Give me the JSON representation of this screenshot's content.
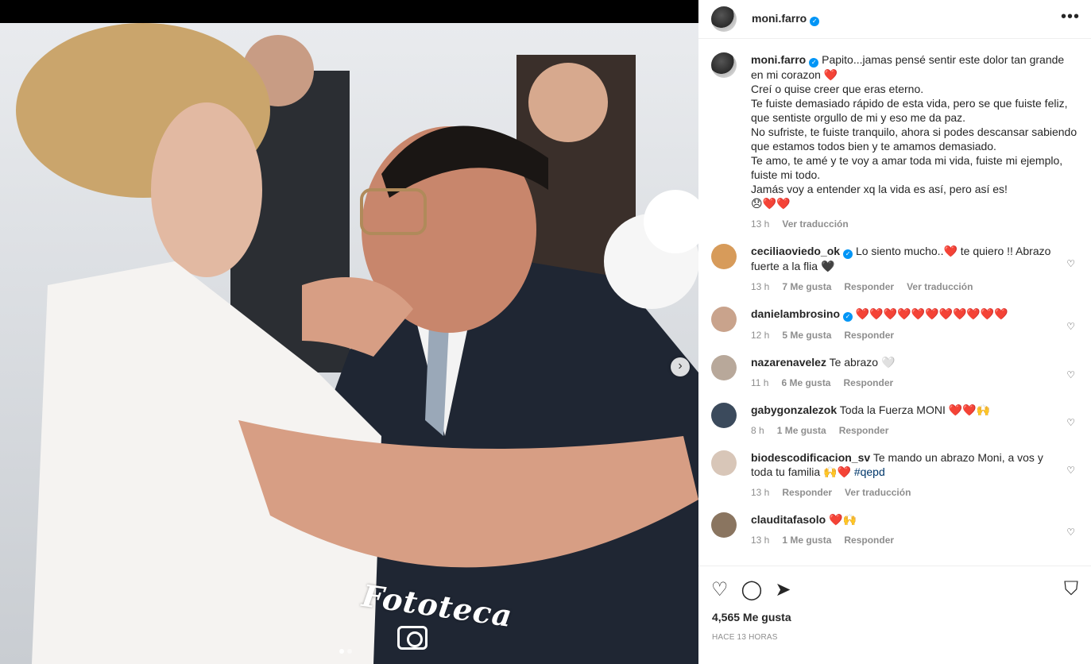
{
  "post": {
    "username": "moni.farro",
    "watermark": "Fototeca",
    "more_label": "•••"
  },
  "caption": {
    "username": "moni.farro",
    "text": "Papito...jamas pensé sentir este dolor tan grande en mi corazon ❤️\nCreí o quise creer que eras eterno.\nTe fuiste demasiado rápido de esta vida, pero se que fuiste feliz, que sentiste orgullo de mi y eso me da paz.\nNo sufriste, te fuiste tranquilo, ahora si podes descansar sabiendo que estamos todos bien y te amamos demasiado.\nTe amo, te amé y te voy a amar toda mi vida, fuiste mi ejemplo, fuiste mi todo.\nJamás voy a entender xq la vida es así, pero así es!\n😞❤️❤️",
    "time": "13 h",
    "translate": "Ver traducción"
  },
  "comments": [
    {
      "username": "ceciliaoviedo_ok",
      "verified": true,
      "text": "Lo siento mucho..❤️ te quiero !! Abrazo fuerte a la flia 🖤",
      "time": "13 h",
      "likes": "7 Me gusta",
      "reply": "Responder",
      "translate": "Ver traducción",
      "avatar_color": "#d79b5a"
    },
    {
      "username": "danielambrosino",
      "verified": true,
      "text": "❤️❤️❤️❤️❤️❤️❤️❤️❤️❤️❤️",
      "time": "12 h",
      "likes": "5 Me gusta",
      "reply": "Responder",
      "translate": "",
      "avatar_color": "#c9a38c"
    },
    {
      "username": "nazarenavelez",
      "verified": false,
      "text": "Te abrazo 🤍",
      "time": "11 h",
      "likes": "6 Me gusta",
      "reply": "Responder",
      "translate": "",
      "avatar_color": "#b8a89a"
    },
    {
      "username": "gabygonzalezok",
      "verified": false,
      "text": "Toda la Fuerza MONI ❤️❤️🙌",
      "time": "8 h",
      "likes": "1 Me gusta",
      "reply": "Responder",
      "translate": "",
      "avatar_color": "#3b4a5c"
    },
    {
      "username": "biodescodificacion_sv",
      "verified": false,
      "text": "Te mando un abrazo Moni, a vos y toda tu familia 🙌❤️ ",
      "hashtag": "#qepd",
      "time": "13 h",
      "likes": "",
      "reply": "Responder",
      "translate": "Ver traducción",
      "avatar_color": "#d8c6b8"
    },
    {
      "username": "clauditafasolo",
      "verified": false,
      "text": "❤️🙌",
      "time": "13 h",
      "likes": "1 Me gusta",
      "reply": "Responder",
      "translate": "",
      "avatar_color": "#8a7560"
    }
  ],
  "footer": {
    "likes": "4,565 Me gusta",
    "ago": "HACE 13 HORAS"
  },
  "colors": {
    "accent": "#0095f6",
    "heart": "#ed4956",
    "muted": "#8e8e8e",
    "hashtag": "#00376b"
  }
}
